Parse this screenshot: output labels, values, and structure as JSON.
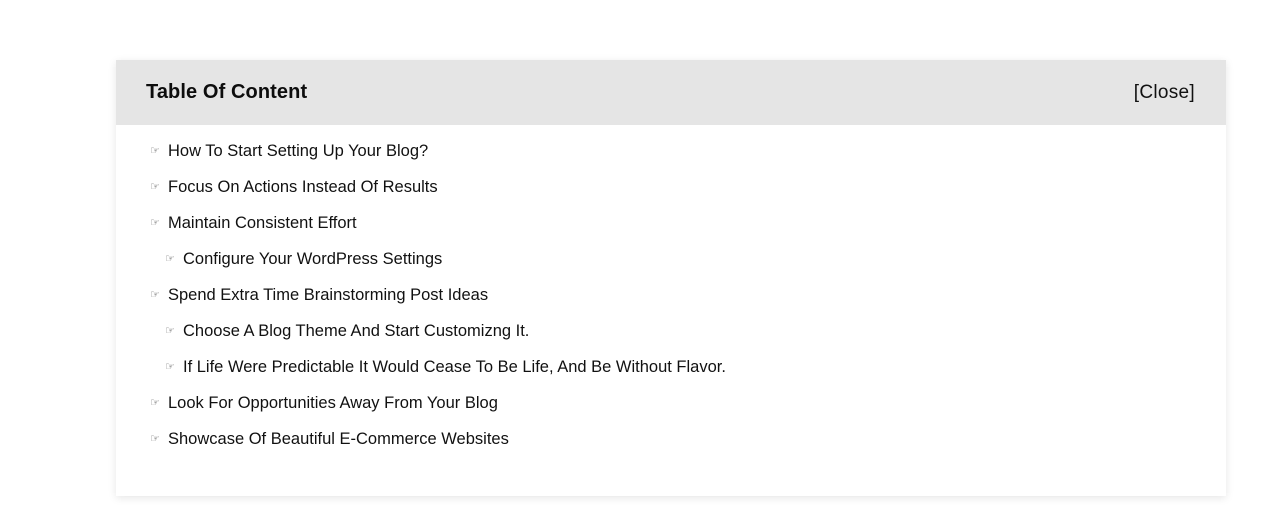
{
  "toc": {
    "title": "Table Of Content",
    "close_label": "[Close]",
    "bullet_glyph": "☞",
    "items": [
      {
        "label": "How To Start Setting Up Your Blog?",
        "level": 1
      },
      {
        "label": "Focus On Actions Instead Of Results",
        "level": 1
      },
      {
        "label": "Maintain Consistent Effort",
        "level": 1
      },
      {
        "label": "Configure Your WordPress Settings",
        "level": 2
      },
      {
        "label": "Spend Extra Time Brainstorming Post Ideas",
        "level": 1
      },
      {
        "label": "Choose A Blog Theme And Start Customizng It.",
        "level": 2
      },
      {
        "label": "If Life Were Predictable It Would Cease To Be Life, And Be Without Flavor.",
        "level": 2
      },
      {
        "label": "Look For Opportunities Away From Your Blog",
        "level": 1
      },
      {
        "label": "Showcase Of Beautiful E-Commerce Websites",
        "level": 1
      }
    ]
  }
}
